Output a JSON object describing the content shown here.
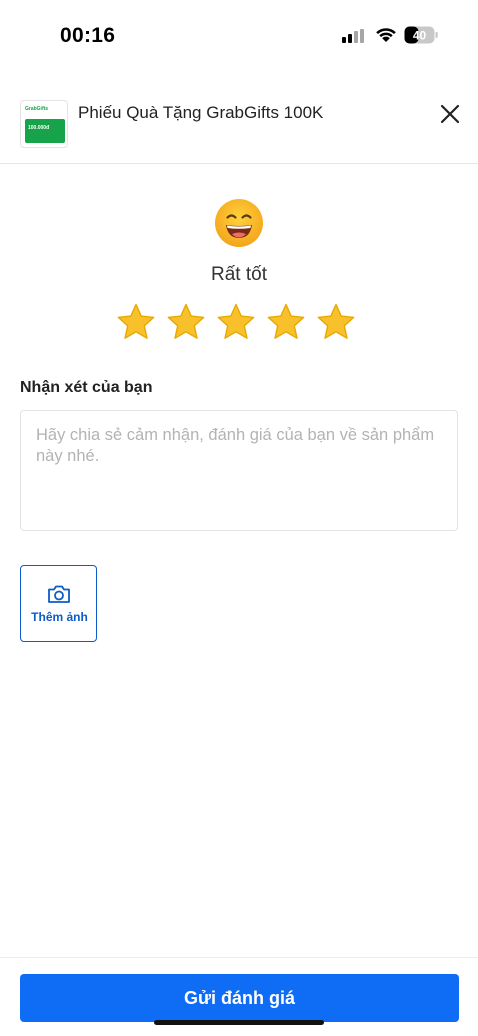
{
  "status_bar": {
    "time": "00:16",
    "battery_level": "40",
    "icons": [
      "signal-icon",
      "wifi-icon",
      "battery-icon"
    ]
  },
  "header": {
    "product_title": "Phiếu Quà Tặng GrabGifts 100K",
    "thumbnail_logo": "GrabGifts",
    "thumbnail_amount": "100.000đ",
    "close_icon": "close-icon",
    "thumbnail_accent": "#16a34a"
  },
  "rating": {
    "emoji_icon": "grinning-face-icon",
    "label": "Rất tốt",
    "value": 5,
    "max": 5,
    "star_color": "#f8c12c"
  },
  "comment": {
    "label": "Nhận xét của bạn",
    "value": "",
    "placeholder": "Hãy chia sẻ cảm nhận, đánh giá của bạn về sản phẩm này nhé."
  },
  "add_photo": {
    "label": "Thêm ảnh",
    "icon": "camera-icon",
    "color": "#0d5cc9"
  },
  "footer": {
    "submit_label": "Gửi đánh giá",
    "button_color": "#0f6cf5"
  }
}
